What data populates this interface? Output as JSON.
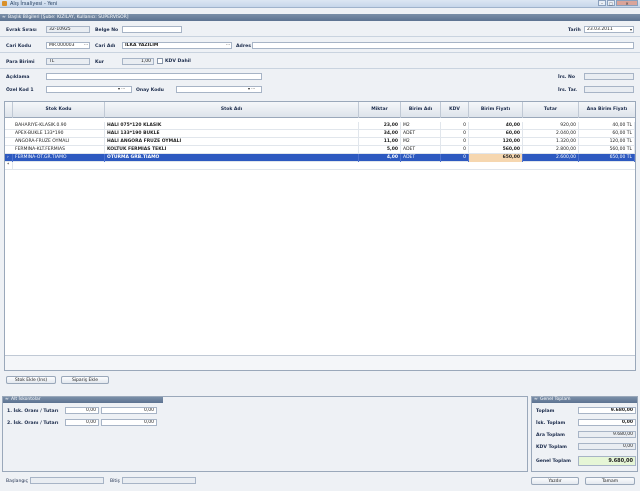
{
  "window": {
    "title": "Alış İrsaliyesi - Yeni",
    "icon": "app-icon"
  },
  "header_section": {
    "title": "Başlık Bilgileri [Şube: KIZILAY, Kullanıcı: SUPERVISOR]"
  },
  "form": {
    "evrak_sirasi_label": "Evrak Sırası",
    "evrak_sirasi_value": "32-10925",
    "belge_no_label": "Belge No",
    "belge_no_value": "",
    "tarih_label": "Tarih",
    "tarih_value": "23.03.2011",
    "cari_kodu_label": "Cari Kodu",
    "cari_kodu_value": "MR.000003",
    "cari_adi_label": "Cari Adı",
    "cari_adi_value": "İLKA YAZILIM",
    "adres_label": "Adres",
    "adres_value": "",
    "para_birimi_label": "Para Birimi",
    "para_birimi_value": "TL",
    "kur_label": "Kur",
    "kur_value": "1,00",
    "kdv_dahil_label": "KDV Dahil",
    "aciklama_label": "Açıklama",
    "aciklama_value": "",
    "irs_no_label": "İrs. No",
    "irs_no_value": "",
    "ozel_kod_label": "Özel Kod 1",
    "ozel_kod_value": "",
    "onay_kodu_label": "Onay Kodu",
    "onay_kodu_value": "",
    "irs_tar_label": "İrs. Tar.",
    "irs_tar_value": ""
  },
  "grid": {
    "columns": [
      "Stok Kodu",
      "Stok Adı",
      "Miktar",
      "Birim Adı",
      "KDV",
      "Birim Fiyatı",
      "Tutar",
      "Ana Birim Fiyatı"
    ],
    "rows": [
      {
        "kod": "BAHARIYE-KLASIK.0.90",
        "ad": "HALI 075*120 KLASIK",
        "miktar": "23,00",
        "birim": "M2",
        "kdv": "0",
        "fiyat": "40,00",
        "tutar": "920,00",
        "ana": "40,00 TL"
      },
      {
        "kod": "APEX-BUKLE 133*190",
        "ad": "HALI 133*190 BUKLE",
        "miktar": "34,00",
        "birim": "ADET",
        "kdv": "0",
        "fiyat": "60,00",
        "tutar": "2.040,00",
        "ana": "60,00 TL"
      },
      {
        "kod": "ANGORA-FRUZE OYMALI",
        "ad": "HALI ANGORA FRUZE OYMALI",
        "miktar": "11,00",
        "birim": "M2",
        "kdv": "0",
        "fiyat": "120,00",
        "tutar": "1.320,00",
        "ana": "120,00 TL"
      },
      {
        "kod": "FERMINA-KLT.FERMIAS",
        "ad": "KOLTUK FERMIAS TEKLI",
        "miktar": "5,00",
        "birim": "ADET",
        "kdv": "0",
        "fiyat": "560,00",
        "tutar": "2.800,00",
        "ana": "560,00 TL"
      },
      {
        "kod": "FERMINA-OT.GR.TIAMO",
        "ad": "OTURMA GRB.TIAMO",
        "miktar": "4,00",
        "birim": "ADET",
        "kdv": "0",
        "fiyat": "650,00",
        "tutar": "2.600,00",
        "ana": "650,00 TL"
      }
    ]
  },
  "buttons": {
    "stok_ekle": "Stok Ekle (Ins)",
    "siparis_ekle": "Sipariş Ekle",
    "yazdir": "Yazdır",
    "tamam": "Tamam"
  },
  "alt_iskontolar": {
    "title": "Alt İskontolar",
    "isk1_label": "1. İsk. Oranı / Tutarı",
    "isk1_oran": "0,00",
    "isk1_tutar": "0,00",
    "isk2_label": "2. İsk. Oranı / Tutarı",
    "isk2_oran": "0,00",
    "isk2_tutar": "0,00"
  },
  "genel_toplam": {
    "title": "Genel Toplam",
    "toplam_label": "Toplam",
    "toplam": "9.680,00",
    "isk_label": "İsk. Toplam",
    "isk": "0,00",
    "ara_label": "Ara Toplam",
    "ara": "9.680,00",
    "kdv_label": "KDV Toplam",
    "kdv": "0,00",
    "genel_label": "Genel Toplam",
    "genel": "9.680,00"
  },
  "footer": {
    "baslangic_label": "Başlangıç",
    "baslangic": "",
    "bitis_label": "Bitiş",
    "bitis": ""
  }
}
